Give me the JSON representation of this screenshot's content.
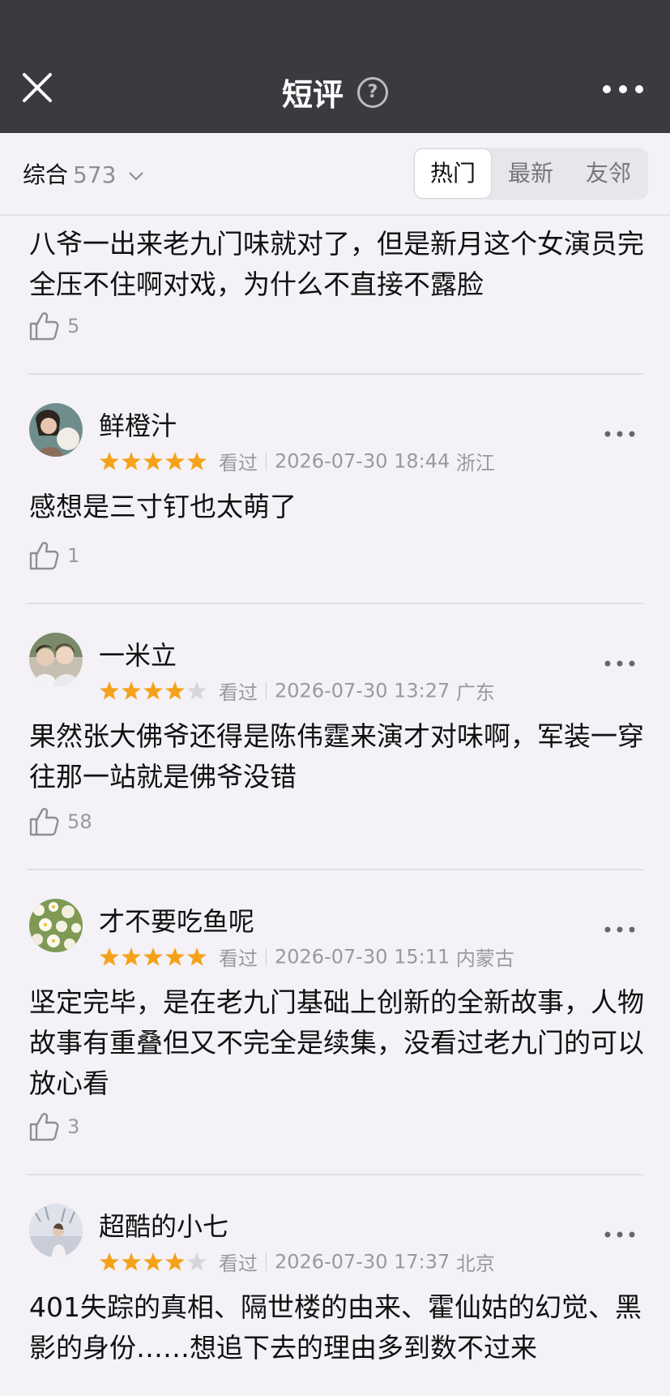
{
  "nav": {
    "title": "短评",
    "help_glyph": "?"
  },
  "filter": {
    "sort_label": "综合",
    "sort_count": "573",
    "tabs": [
      "热门",
      "最新",
      "友邻"
    ],
    "active_tab": "热门"
  },
  "colors": {
    "star": "#f5a21b",
    "star_empty": "#d6d5d9",
    "navbar": "#3b3a40"
  },
  "first_review": {
    "text": "八爷一出来老九门味就对了，但是新月这个女演员完全压不住啊对戏，为什么不直接不露脸",
    "likes": "5"
  },
  "reviews": [
    {
      "user": "鲜橙汁",
      "rating": 5,
      "status": "看过",
      "date": "2026-07-30 18:44",
      "location": "浙江",
      "text": "感想是三寸钉也太萌了",
      "likes": "1"
    },
    {
      "user": "一米立",
      "rating": 4,
      "status": "看过",
      "date": "2026-07-30 13:27",
      "location": "广东",
      "text": "果然张大佛爷还得是陈伟霆来演才对味啊，军装一穿往那一站就是佛爷没错",
      "likes": "58"
    },
    {
      "user": "才不要吃鱼呢",
      "rating": 5,
      "status": "看过",
      "date": "2026-07-30 15:11",
      "location": "内蒙古",
      "text": "坚定完毕，是在老九门基础上创新的全新故事，人物故事有重叠但又不完全是续集，没看过老九门的可以放心看",
      "likes": "3"
    },
    {
      "user": "超酷的小七",
      "rating": 4,
      "status": "看过",
      "date": "2026-07-30 17:37",
      "location": "北京",
      "text": "401失踪的真相、隔世楼的由来、霍仙姑的幻觉、黑影的身份……想追下去的理由多到数不过来"
    }
  ]
}
